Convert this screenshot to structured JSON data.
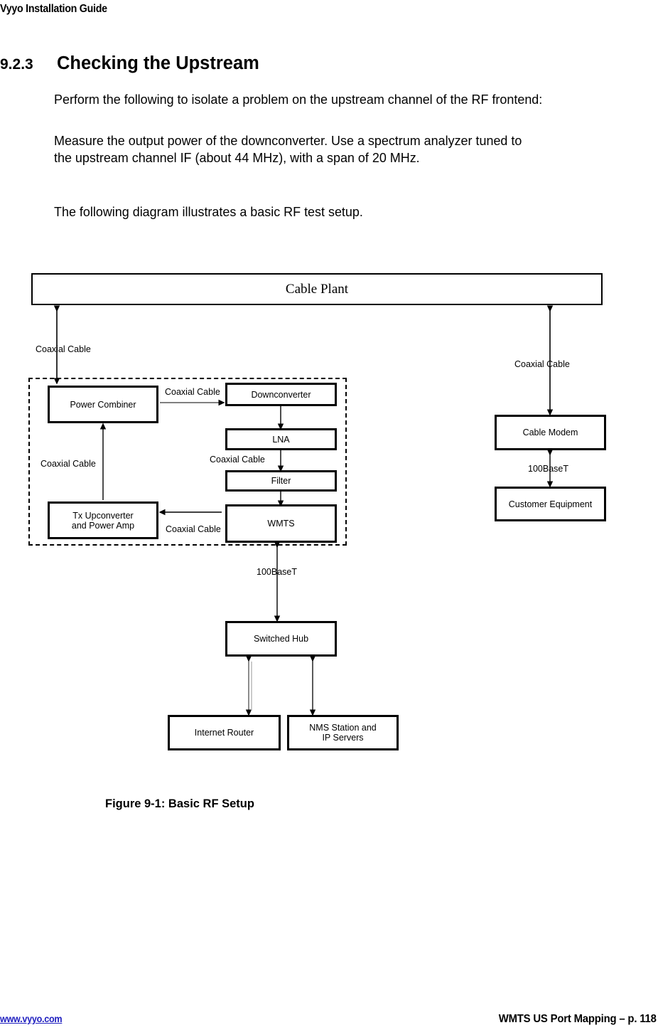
{
  "header": {
    "title": "Vyyo Installation Guide"
  },
  "section": {
    "number": "9.2.3",
    "title": "Checking the Upstream"
  },
  "body": {
    "paragraph_1": "Perform the following to isolate a problem on the upstream channel of the RF frontend:",
    "paragraph_2": "Measure the output power of the downconverter.  Use a spectrum analyzer tuned to the upstream channel IF (about 44 MHz), with a span of 20 MHz.",
    "paragraph_3": "The following diagram illustrates a basic RF test setup."
  },
  "diagram": {
    "boxes": {
      "cable_plant": "Cable Plant",
      "power_combiner": "Power Combiner",
      "downconverter": "Downconverter",
      "lna": "LNA",
      "filter": "Filter",
      "wmts": "WMTS",
      "tx_upconverter_line1": "Tx  Upconverter",
      "tx_upconverter_line2": "and Power Amp",
      "cable_modem": "Cable Modem",
      "customer_equipment": "Customer Equipment",
      "switched_hub": "Switched Hub",
      "internet_router": "Internet Router",
      "nms_station_line1": "NMS Station and",
      "nms_station_line2": "IP Servers"
    },
    "link_labels": {
      "plant_to_combiner": "Coaxial Cable",
      "combiner_to_downconverter": "Coaxial Cable",
      "lna_to_filter": "Coaxial Cable",
      "upconverter_to_combiner": "Coaxial Cable",
      "wmts_to_upconverter": "Coaxial Cable",
      "plant_to_modem": "Coaxial Cable",
      "modem_to_customer": "100BaseT",
      "wmts_to_hub": "100BaseT"
    },
    "colors": {
      "stroke": "#000000",
      "fill": "#ffffff"
    }
  },
  "figure": {
    "caption": "Figure 9-1: Basic RF Setup"
  },
  "footer": {
    "url": "www.vyyo.com",
    "page_info": "WMTS US Port Mapping – p. 118"
  }
}
